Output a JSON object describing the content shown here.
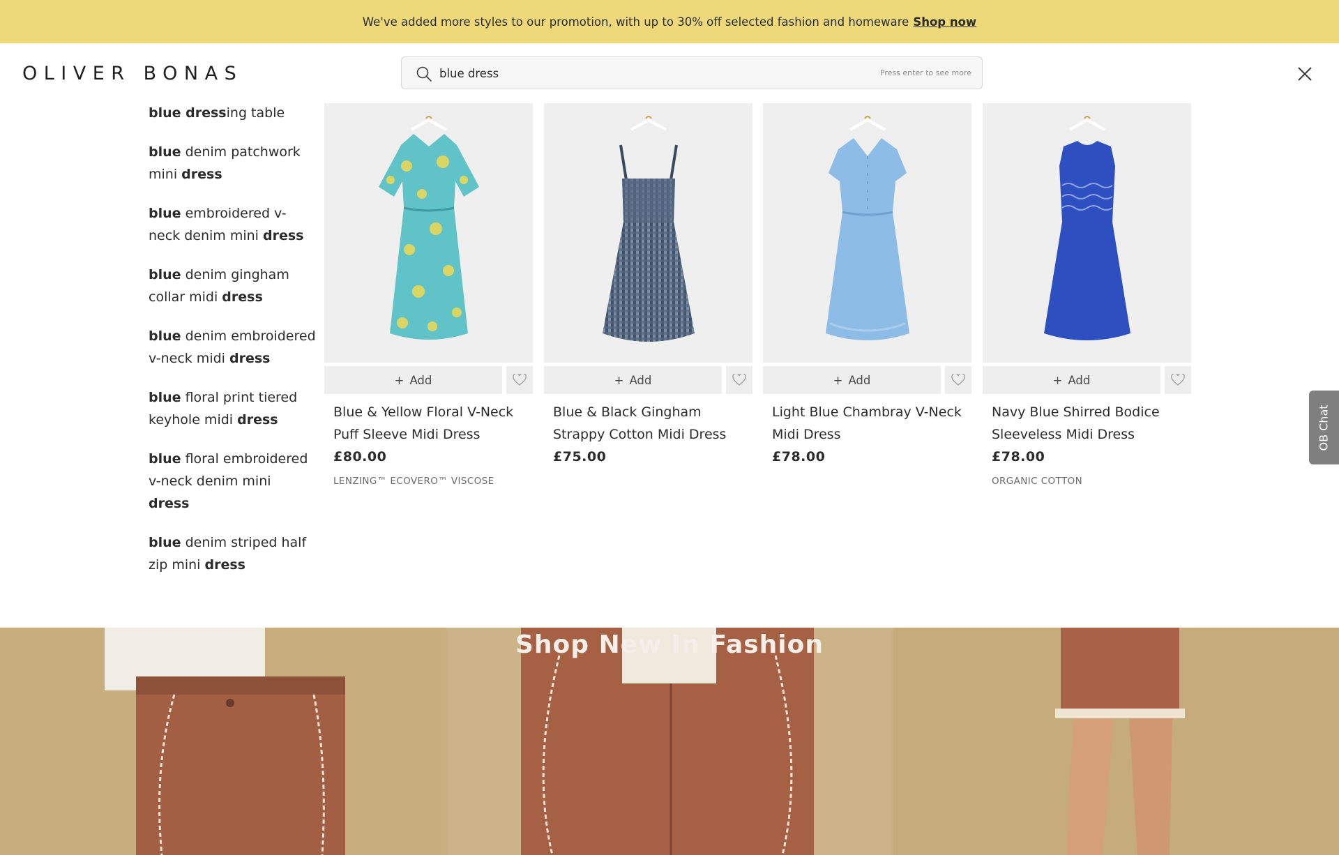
{
  "promo": {
    "text": "We've added more styles to our promotion, with up to 30% off selected fashion and homeware",
    "link": "Shop now"
  },
  "header": {
    "logo": "OLIVER BONAS",
    "search": {
      "value": "blue dress",
      "hint": "Press enter to see more"
    }
  },
  "suggestions": [
    {
      "pre": "blue dress",
      "post": "ing table"
    },
    {
      "pre": "blue",
      "mid": " denim patchwork mini ",
      "post": "dress"
    },
    {
      "pre": "blue",
      "mid": " embroidered v-neck denim mini ",
      "post": "dress"
    },
    {
      "pre": "blue",
      "mid": " denim gingham collar midi ",
      "post": "dress"
    },
    {
      "pre": "blue",
      "mid": " denim embroidered v-neck midi ",
      "post": "dress"
    },
    {
      "pre": "blue",
      "mid": " floral print tiered keyhole midi ",
      "post": "dress"
    },
    {
      "pre": "blue",
      "mid": " floral embroidered v-neck denim mini ",
      "post": "dress"
    },
    {
      "pre": "blue",
      "mid": " denim striped half zip mini ",
      "post": "dress"
    }
  ],
  "add_label": "Add",
  "products": [
    {
      "name": "Blue & Yellow Floral V-Neck Puff Sleeve Midi Dress",
      "price": "£80.00",
      "tag": "LENZING™ ECOVERO™ VISCOSE",
      "color": "#5fc3c7",
      "accent": "#e9d95a"
    },
    {
      "name": "Blue & Black Gingham Strappy Cotton Midi Dress",
      "price": "£75.00",
      "tag": "",
      "color": "#5b7089",
      "accent": "#3a4a5e"
    },
    {
      "name": "Light Blue Chambray V-Neck Midi Dress",
      "price": "£78.00",
      "tag": "",
      "color": "#8dbde6",
      "accent": "#a9cdee"
    },
    {
      "name": "Navy Blue Shirred Bodice Sleeveless Midi Dress",
      "price": "£78.00",
      "tag": "ORGANIC COTTON",
      "color": "#2e4fbf",
      "accent": "#6f86d6"
    }
  ],
  "chat": {
    "label": "OB Chat"
  },
  "hero": {
    "title": "Shop New In Fashion"
  },
  "colors": {
    "banner": "#eed97a",
    "chat": "#7f7f7f",
    "image_bg": "#efefef"
  }
}
